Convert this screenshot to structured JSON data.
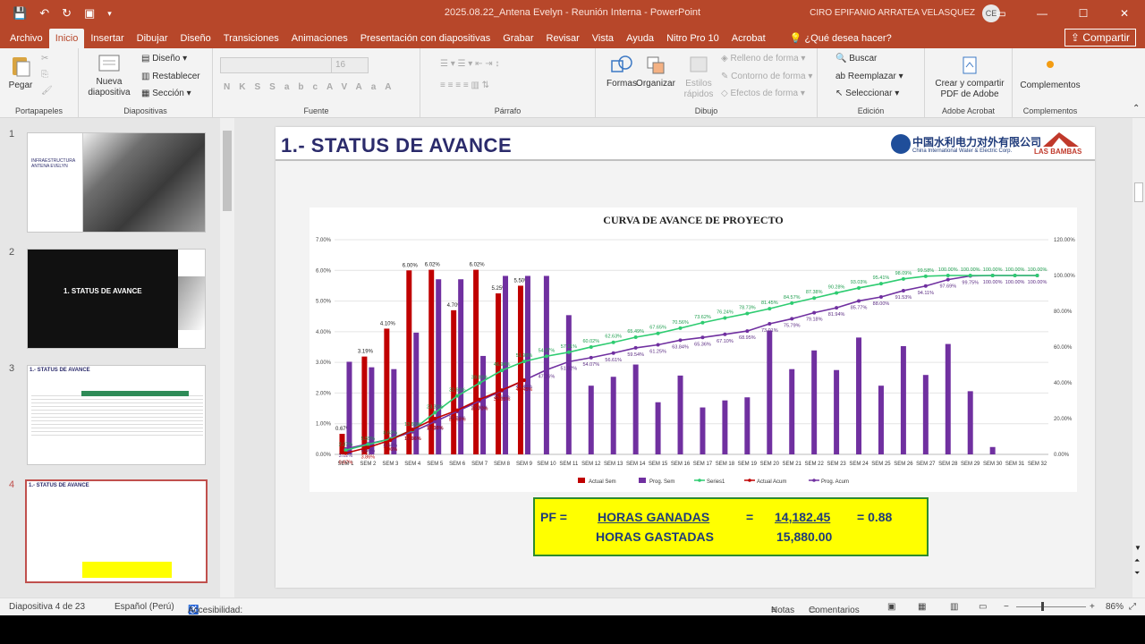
{
  "titlebar": {
    "doc_title": "2025.08.22_Antena Evelyn - Reunión Interna - PowerPoint",
    "user": "CIRO EPIFANIO ARRATEA VELASQUEZ",
    "avatar_initials": "CE"
  },
  "menu": {
    "tabs": [
      "Archivo",
      "Inicio",
      "Insertar",
      "Dibujar",
      "Diseño",
      "Transiciones",
      "Animaciones",
      "Presentación con diapositivas",
      "Grabar",
      "Revisar",
      "Vista",
      "Ayuda",
      "Nitro Pro 10",
      "Acrobat"
    ],
    "active_tab": "Inicio",
    "tell_me": "¿Qué desea hacer?",
    "share": "Compartir"
  },
  "ribbon": {
    "pegar": "Pegar",
    "portapapeles": "Portapapeles",
    "nueva": "Nueva",
    "diapositiva": "diapositiva",
    "diseno": "Diseño",
    "restablecer": "Restablecer",
    "seccion": "Sección",
    "diapositivas": "Diapositivas",
    "font_size": "16",
    "fuente": "Fuente",
    "parrafo": "Párrafo",
    "formas": "Formas",
    "organizar": "Organizar",
    "estilos": "Estilos",
    "rapidos": "rápidos",
    "relleno": "Relleno de forma",
    "contorno": "Contorno de forma",
    "efectos": "Efectos de forma",
    "dibujo": "Dibujo",
    "buscar": "Buscar",
    "reemplazar": "Reemplazar",
    "seleccionar": "Seleccionar",
    "edicion": "Edición",
    "crear1": "Crear y compartir",
    "crear2": "PDF de Adobe",
    "adobe": "Adobe Acrobat",
    "complementos": "Complementos",
    "complementos_grp": "Complementos",
    "fmt_letters": [
      "N",
      "K",
      "S",
      "S",
      "abc",
      "AV",
      "Aa",
      "A"
    ]
  },
  "thumbnails": [
    {
      "num": "1",
      "title": "INFRAESTRUCTURA ANTENA EVELYN"
    },
    {
      "num": "2",
      "title": "1. STATUS DE AVANCE"
    },
    {
      "num": "3",
      "title": "1.- STATUS DE AVANCE"
    },
    {
      "num": "4",
      "title": "1.- STATUS DE AVANCE"
    }
  ],
  "slide": {
    "title": "1.- STATUS DE AVANCE",
    "logo_cn": "中国水利电力对外有限公司",
    "logo_en": "China International Water & Electric Corp.",
    "logo2": "LAS BAMBAS",
    "pf": {
      "label": "PF =",
      "num_label": "HORAS GANADAS",
      "den_label": "HORAS GASTADAS",
      "eq": "=",
      "num_value": "14,182.45",
      "den_value": "15,880.00",
      "result": "= 0.88"
    }
  },
  "chart_data": {
    "type": "bar",
    "title": "CURVA DE AVANCE DE PROYECTO",
    "categories": [
      "SEM 1",
      "SEM 2",
      "SEM 3",
      "SEM 4",
      "SEM 5",
      "SEM 6",
      "SEM 7",
      "SEM 8",
      "SEM 9",
      "SEM 10",
      "SEM 11",
      "SEM 12",
      "SEM 13",
      "SEM 14",
      "SEM 15",
      "SEM 16",
      "SEM 17",
      "SEM 18",
      "SEM 19",
      "SEM 20",
      "SEM 21",
      "SEM 22",
      "SEM 23",
      "SEM 24",
      "SEM 25",
      "SEM 26",
      "SEM 27",
      "SEM 28",
      "SEM 29",
      "SEM 30",
      "SEM 31",
      "SEM 32"
    ],
    "y_left": {
      "min": 0,
      "max": 7,
      "ticks": [
        "0.00%",
        "1.00%",
        "2.00%",
        "3.00%",
        "4.00%",
        "5.00%",
        "6.00%",
        "7.00%"
      ]
    },
    "y_right": {
      "min": 0,
      "max": 120,
      "ticks": [
        "0.00%",
        "20.00%",
        "40.00%",
        "60.00%",
        "80.00%",
        "100.00%",
        "120.00%"
      ]
    },
    "series": [
      {
        "name": "Actual Sem",
        "axis": "left",
        "type": "bar",
        "color": "#c00000",
        "values": [
          0.67,
          3.19,
          4.1,
          6.0,
          6.02,
          4.7,
          6.02,
          5.25,
          5.5,
          null,
          null,
          null,
          null,
          null,
          null,
          null,
          null,
          null,
          null,
          null,
          null,
          null,
          null,
          null,
          null,
          null,
          null,
          null,
          null,
          null,
          null,
          null
        ],
        "labels": [
          "0.67%",
          "3.19%",
          "4.10%",
          "6.00%",
          "6.02%",
          "4.70%",
          "6.02%",
          "5.25%",
          "5.50%"
        ]
      },
      {
        "name": "Prog. Sem",
        "axis": "left",
        "type": "bar",
        "color": "#7030a0",
        "values": [
          3.02,
          2.84,
          2.78,
          3.97,
          5.71,
          5.71,
          3.21,
          5.82,
          5.82,
          5.82,
          4.54,
          2.24,
          2.53,
          2.93,
          1.7,
          2.57,
          1.53,
          1.76,
          1.86,
          4.04,
          2.78,
          3.39,
          2.75,
          3.81,
          2.24,
          3.53,
          2.59,
          3.6,
          2.06,
          0.24,
          0,
          0
        ]
      },
      {
        "name": "Series1",
        "axis": "right",
        "type": "line",
        "color": "#2ecc71",
        "values": [
          2.37,
          5.55,
          8.63,
          13.6,
          23.33,
          32.66,
          39.86,
          46.94,
          51.96,
          54.87,
          57.11,
          60.02,
          62.63,
          65.49,
          67.65,
          70.56,
          73.62,
          76.24,
          78.73,
          81.45,
          84.57,
          87.38,
          90.28,
          93.03,
          95.41,
          98.09,
          99.58,
          100.0,
          100.0,
          100.0,
          100.0,
          100.0
        ],
        "labels": [
          "2.37%",
          "5.55%",
          "8.63%",
          "13.60%",
          "23.33%",
          "32.66%",
          "39.86%",
          "46.94%",
          "51.96%",
          "54.87%",
          "57.11%",
          "60.02%",
          "62.63%",
          "65.49%",
          "67.65%",
          "70.56%",
          "73.62%",
          "76.24%",
          "78.73%",
          "81.45%",
          "84.57%",
          "87.38%",
          "90.28%",
          "93.03%",
          "95.41%",
          "98.09%",
          "99.58%",
          "100.00%",
          "100.00%",
          "100.00%",
          "100.00%",
          "100.00%"
        ]
      },
      {
        "name": "Actual Acum",
        "axis": "right",
        "type": "line",
        "color": "#c00000",
        "values": [
          0.67,
          3.86,
          7.96,
          13.96,
          19.98,
          24.68,
          30.7,
          35.95,
          41.45
        ],
        "labels": [
          "0.67%",
          "3.86%",
          "7.96%",
          "13.96%",
          "19.98%",
          "24.68%",
          "30.70%",
          "35.95%",
          "41.45%"
        ]
      },
      {
        "name": "Prog. Acum",
        "axis": "right",
        "type": "line",
        "color": "#7030a0",
        "values": [
          3.02,
          5.86,
          8.64,
          12.61,
          18.32,
          24.03,
          29.83,
          35.64,
          41.45,
          47.26,
          51.82,
          54.07,
          56.61,
          59.54,
          61.25,
          63.84,
          65.36,
          67.1,
          68.95,
          73.01,
          75.79,
          79.18,
          81.94,
          85.77,
          88.0,
          91.53,
          94.11,
          97.69,
          99.75,
          100.0,
          100.0,
          100.0
        ],
        "labels": [
          "3.02%",
          "5.86%",
          "8.64%",
          "12.61%",
          "18.32%",
          "24.03%",
          "29.83%",
          "35.64%",
          "41.45%",
          "47.26%",
          "51.82%",
          "54.07%",
          "56.61%",
          "59.54%",
          "61.25%",
          "63.84%",
          "65.36%",
          "67.10%",
          "68.95%",
          "73.01%",
          "75.79%",
          "79.18%",
          "81.94%",
          "85.77%",
          "88.00%",
          "91.53%",
          "94.11%",
          "97.69%",
          "99.75%",
          "100.00%",
          "100.00%",
          "100.00%"
        ]
      }
    ],
    "legend_position": "bottom",
    "grid": true
  },
  "status": {
    "slide_info": "Diapositiva 4 de 23",
    "language": "Español (Perú)",
    "accessibility": "Accesibilidad: todo correcto",
    "notes": "Notas",
    "comments": "Comentarios",
    "zoom": "86%"
  }
}
